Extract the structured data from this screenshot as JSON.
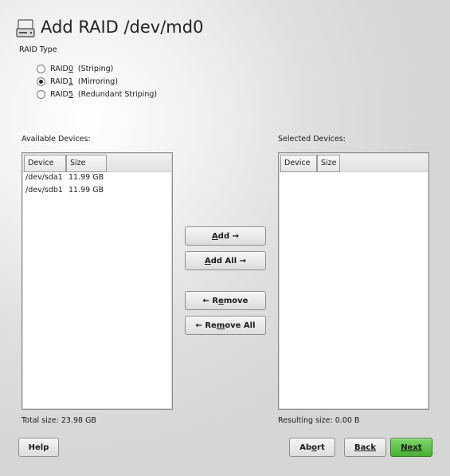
{
  "header": {
    "title": "Add RAID /dev/md0",
    "icon": "harddisk-icon"
  },
  "raid_type": {
    "label": "RAID Type",
    "options": [
      {
        "prefix": "RAID ",
        "key": "0",
        "suffix": "  (Striping)",
        "checked": false
      },
      {
        "prefix": "RAID ",
        "key": "1",
        "suffix": "  (Mirroring)",
        "checked": true
      },
      {
        "prefix": "RAID ",
        "key": "5",
        "suffix": "  (Redundant Striping)",
        "checked": false
      }
    ]
  },
  "available": {
    "label": "Available Devices:",
    "columns": [
      "Device",
      "Size"
    ],
    "rows": [
      {
        "device": "/dev/sda1",
        "size": "11.99 GB"
      },
      {
        "device": "/dev/sdb1",
        "size": "11.99 GB"
      }
    ],
    "total": "Total size: 23.98 GB"
  },
  "selected": {
    "label": "Selected Devices:",
    "columns": [
      "Device",
      "Size"
    ],
    "rows": [],
    "total": "Resulting size: 0.00 B"
  },
  "transfer": {
    "add": {
      "key": "A",
      "rest": "dd →"
    },
    "add_all": {
      "key": "A",
      "rest": "dd All →"
    },
    "remove": {
      "pre": "← R",
      "key": "e",
      "rest": "move"
    },
    "remove_all": {
      "pre": "← Re",
      "key": "m",
      "rest": "ove All"
    }
  },
  "footer": {
    "help": "Help",
    "abort": {
      "pre": "Ab",
      "key": "o",
      "rest": "rt"
    },
    "back": {
      "key": "B",
      "rest": "ack"
    },
    "next": {
      "key": "N",
      "rest": "ext"
    }
  },
  "colors": {
    "next_button": "#5cc246",
    "panel_border": "#8c8c8c"
  }
}
